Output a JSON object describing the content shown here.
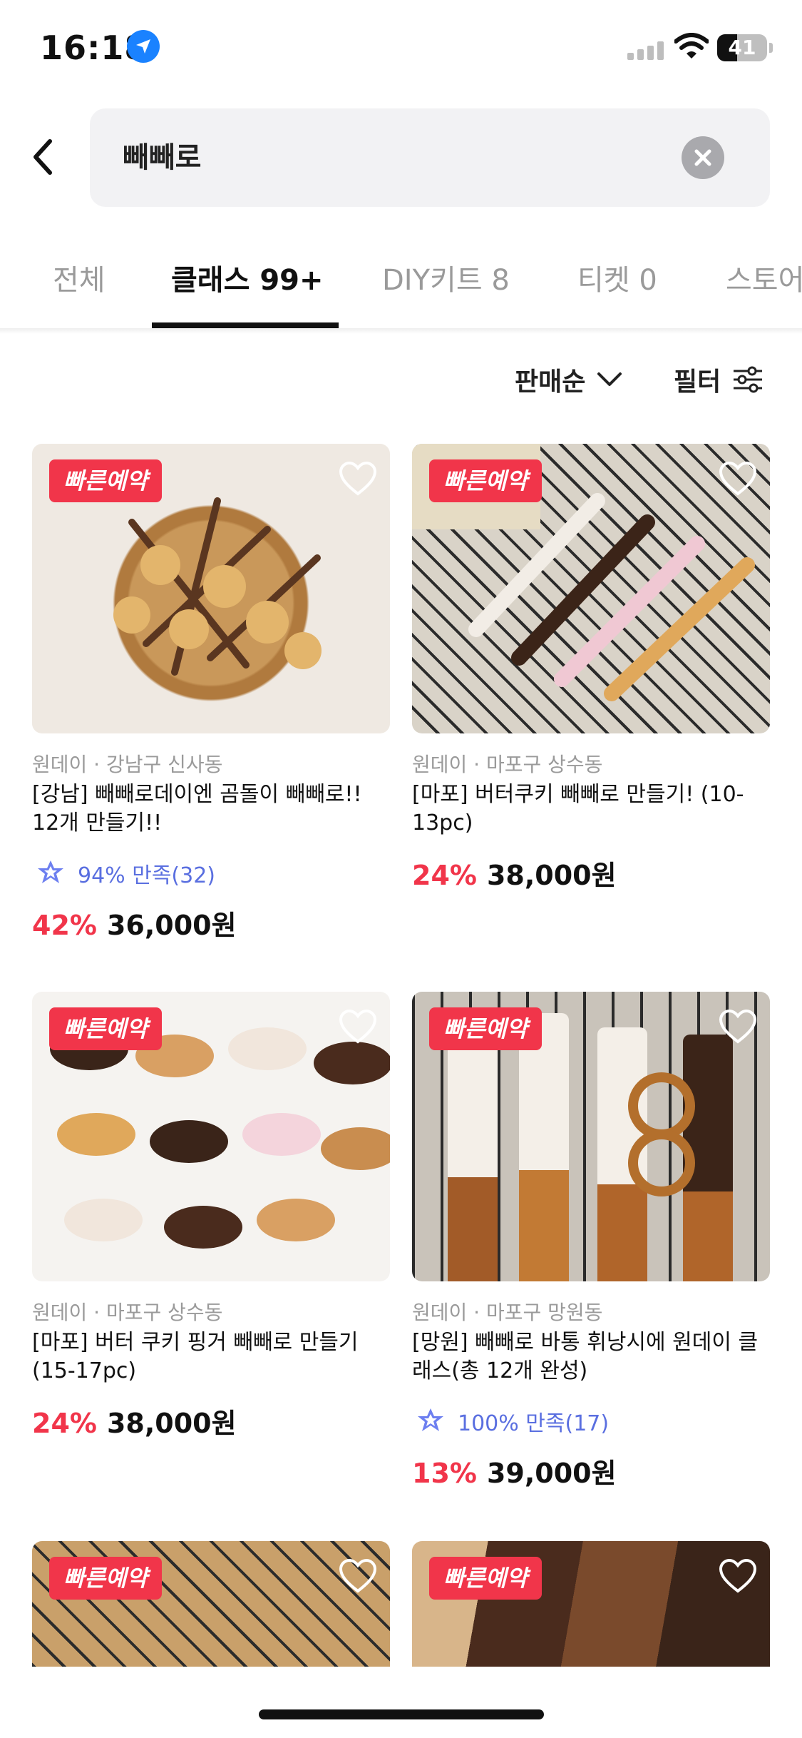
{
  "status_bar": {
    "time": "16:18",
    "battery": "41"
  },
  "search": {
    "query": "빼빼로"
  },
  "tabs": [
    {
      "label": "전체"
    },
    {
      "label": "클래스 99+"
    },
    {
      "label": "DIY키트 8"
    },
    {
      "label": "티켓 0"
    },
    {
      "label": "스토어"
    }
  ],
  "sort": {
    "label": "판매순"
  },
  "filter": {
    "label": "필터"
  },
  "badge_label": "빠른예약",
  "products": [
    {
      "meta": "원데이 · 강남구 신사동",
      "title": "[강남] 빼빼로데이엔 곰돌이 빼빼로!! 12개 만들기!!",
      "rating": "94% 만족(32)",
      "discount": "42%",
      "price": "36,000원"
    },
    {
      "meta": "원데이 · 마포구 상수동",
      "title": "[마포] 버터쿠키 빼빼로 만들기! (10-13pc)",
      "rating": "",
      "discount": "24%",
      "price": "38,000원"
    },
    {
      "meta": "원데이 · 마포구 상수동",
      "title": "[마포] 버터 쿠키 핑거 빼빼로 만들기 (15-17pc)",
      "rating": "",
      "discount": "24%",
      "price": "38,000원"
    },
    {
      "meta": "원데이 · 마포구 망원동",
      "title": "[망원] 빼빼로 바통 휘낭시에 원데이 클래스(총 12개 완성)",
      "rating": "100% 만족(17)",
      "discount": "13%",
      "price": "39,000원"
    }
  ],
  "colors": {
    "accent": "#f1354a",
    "rating": "#5a6fe0"
  },
  "icons": [
    "location-arrow-icon",
    "signal-icon",
    "wifi-icon",
    "battery-icon",
    "back-arrow-icon",
    "clear-icon",
    "chevron-down-icon",
    "filter-sliders-icon",
    "heart-icon",
    "rating-badge-icon"
  ]
}
